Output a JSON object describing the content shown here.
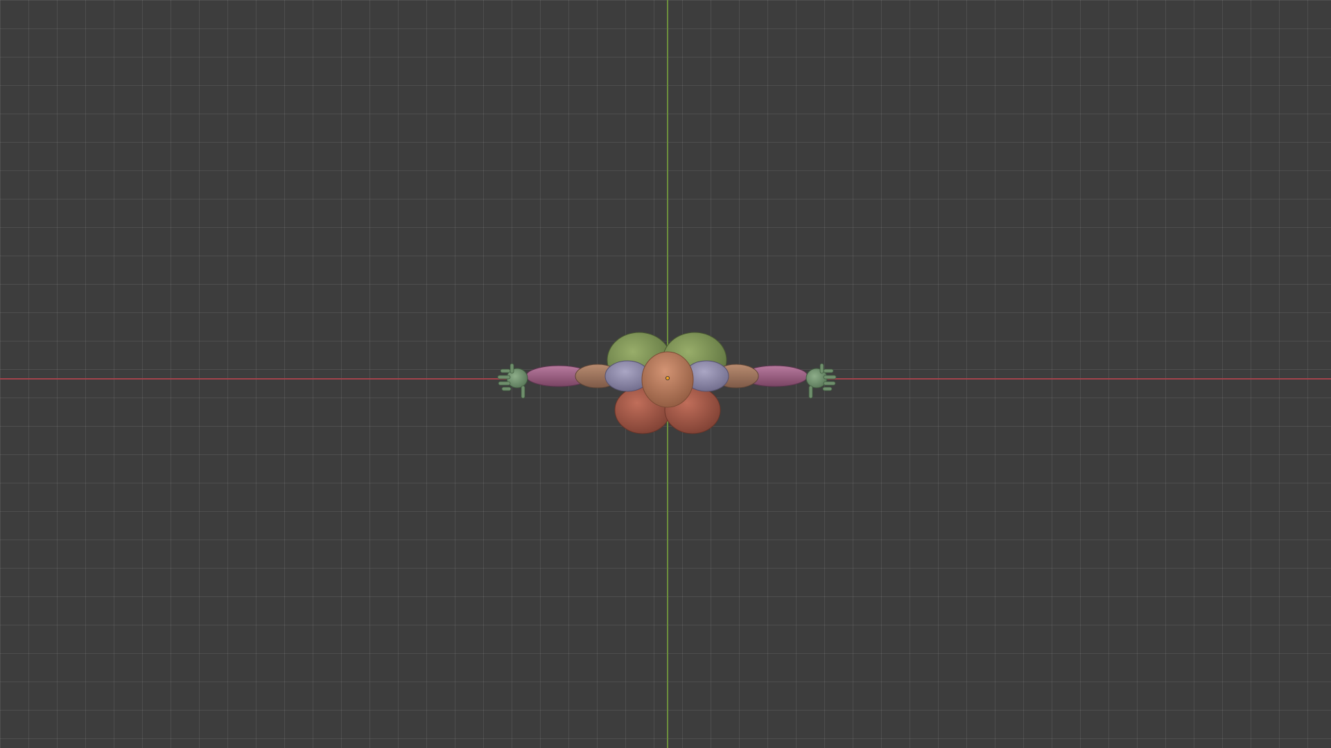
{
  "viewport": {
    "background": "#3d3d3d",
    "view": "top-orthographic",
    "grid": true
  },
  "axes": {
    "x_axis_color": "#a3434c",
    "y_axis_color": "#6c8f3d"
  },
  "model": {
    "type": "mannequin-figure",
    "pose": "T-pose",
    "colors": {
      "head": "#b97b5b",
      "shoulders": "#8e8aa8",
      "upper_arms": "#a0776a",
      "forearms": "#9a5f80",
      "hands": "#6f8f6c",
      "chest": "#7a9050",
      "hips": "#a35a4a",
      "origin": "#f0a020"
    }
  }
}
